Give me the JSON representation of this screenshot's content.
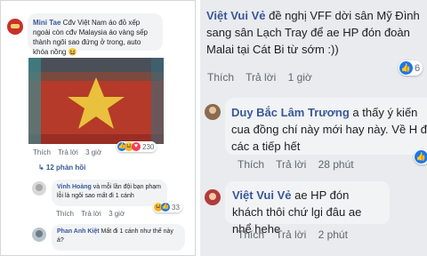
{
  "left": {
    "comment1": {
      "author": "Mini Tae",
      "text": "Cđv Việt Nam áo đỏ xếp ngoài còn cđv Malaysia áo vàng sếp thành ngôi sao đứng ở trong, auto khóa nồng",
      "emoji": "😆",
      "actions": [
        "Thích",
        "Trả lời",
        "3 giờ"
      ],
      "reaction_count": "230"
    },
    "replies_link": "↳ 12 phản hồi",
    "comment2": {
      "author": "Vinh Hoàng",
      "text": "và mỗi lần đội bạn phạm lỗi là ngôi sao mất đi 1 cánh",
      "actions": [
        "Thích",
        "Trả lời",
        "3 giờ"
      ],
      "reaction_count": "33"
    },
    "comment3": {
      "author": "Phan Anh Kiệt",
      "text": "Mất đi 1 cánh như thế này á?"
    }
  },
  "right": {
    "comment1": {
      "author": "Việt Vui Vẻ",
      "text": "đề nghị VFF dời sân Mỹ Đình sang sân Lạch Tray để ae HP đón đoàn Malai tại Cát Bi từ sớm :))",
      "actions": [
        "Thích",
        "Trả lời",
        "1 giờ"
      ],
      "reaction_count": "6"
    },
    "comment2": {
      "author": "Duy Bắc Lâm Trương",
      "text": "a thấy ý kiến cua đồng chí này mới hay này. Về H đi các a tiếp hết",
      "actions": [
        "Thích",
        "Trả lời",
        "28 phút"
      ]
    },
    "comment3": {
      "author": "Việt Vui Vẻ",
      "text": "ae HP đón khách thôi chứ lgi đâu ae nhể hehe",
      "actions": [
        "Thích",
        "Trả lời",
        "2 phút"
      ]
    }
  },
  "colors": {
    "name": "#385898",
    "bubble": "#f2f3f5",
    "right_bg": "#e9ebee",
    "like": "#1877f2",
    "haha": "#f7b125",
    "love": "#f33e58"
  }
}
